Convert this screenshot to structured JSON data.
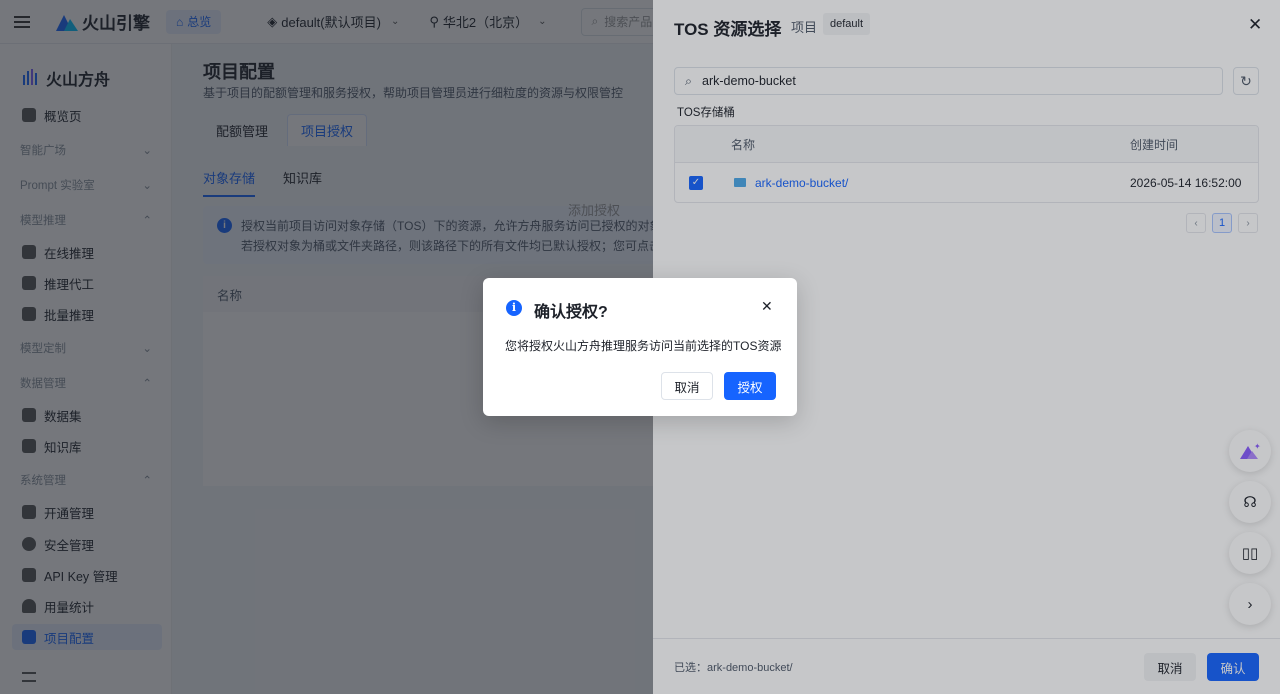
{
  "topbar": {
    "brand": "火山引擎",
    "home": "总览",
    "project": "default(默认项目)",
    "region": "华北2（北京）",
    "search_placeholder": "搜索产品或文"
  },
  "sidebar": {
    "brand": "火山方舟",
    "items": [
      {
        "label": "概览页"
      },
      {
        "label": "在线推理"
      },
      {
        "label": "推理代工"
      },
      {
        "label": "批量推理"
      },
      {
        "label": "数据集"
      },
      {
        "label": "知识库"
      },
      {
        "label": "开通管理"
      },
      {
        "label": "安全管理"
      },
      {
        "label": "API Key 管理"
      },
      {
        "label": "用量统计"
      },
      {
        "label": "项目配置"
      }
    ],
    "sections": [
      "智能广场",
      "Prompt 实验室",
      "模型推理",
      "模型定制",
      "数据管理",
      "系统管理"
    ]
  },
  "page": {
    "title": "项目配置",
    "desc": "基于项目的配额管理和服务授权，帮助项目管理员进行细粒度的资源与权限管控",
    "tabs": [
      "配额管理",
      "项目授权"
    ],
    "subtabs": [
      "对象存储",
      "知识库"
    ],
    "info_line1": "授权当前项目访问对象存储（TOS）下的资源，允许方舟服务访问已授权的对象。",
    "info_line2": "若授权对象为桶或文件夹路径，则该路径下的所有文件均已默认授权；您可点击名称",
    "table_col": "名称",
    "empty_text": "添加授权"
  },
  "drawer": {
    "title": "TOS 资源选择",
    "project_label": "项目",
    "project_tag": "default",
    "search_value": "ark-demo-bucket",
    "section": "TOS存储桶",
    "columns": {
      "name": "名称",
      "created": "创建时间"
    },
    "row": {
      "name": "ark-demo-bucket/",
      "created": "2026-05-14 16:52:00"
    },
    "pager": {
      "current": "1"
    },
    "selected": "已选：ark-demo-bucket/",
    "cancel": "取消",
    "confirm": "确认"
  },
  "modal": {
    "title": "确认授权?",
    "body": "您将授权火山方舟推理服务访问当前选择的TOS资源",
    "cancel": "取消",
    "ok": "授权"
  },
  "colors": {
    "accent": "#1664ff"
  }
}
